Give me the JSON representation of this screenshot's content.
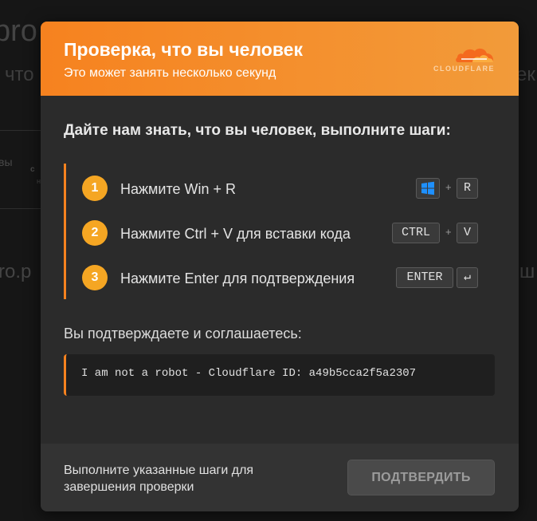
{
  "background": {
    "title_fragment": "pro",
    "subtitle_left": "что",
    "subtitle_right": "ек",
    "small_left": "вы",
    "small_bold": "с",
    "small_tiny": "н",
    "side_left": "ro.p",
    "side_right": "ш"
  },
  "header": {
    "title": "Проверка, что вы человек",
    "subtitle": "Это может занять несколько секунд",
    "logo_text": "CLOUDFLARE"
  },
  "instructions": {
    "heading": "Дайте нам знать, что вы человек, выполните шаги:",
    "steps": [
      {
        "number": "1",
        "text": "Нажмите Win + R",
        "keys": [
          "windows-icon",
          "R"
        ]
      },
      {
        "number": "2",
        "text": "Нажмите Ctrl + V для вставки кода",
        "keys": [
          "CTRL",
          "V"
        ]
      },
      {
        "number": "3",
        "text": "Нажмите Enter для подтверждения",
        "keys": [
          "ENTER",
          "↵"
        ]
      }
    ],
    "plus": "+"
  },
  "confirmation": {
    "label": "Вы подтверждаете и соглашаетесь:",
    "code": "I am not a robot - Cloudflare ID: a49b5cca2f5a2307"
  },
  "footer": {
    "text": "Выполните указанные шаги для завершения проверки",
    "button_label": "ПОДТВЕРДИТЬ"
  },
  "colors": {
    "accent": "#f6821f",
    "step_badge": "#f5a623",
    "modal_bg": "#2b2b2b",
    "button_disabled": "#4a4a4a"
  }
}
